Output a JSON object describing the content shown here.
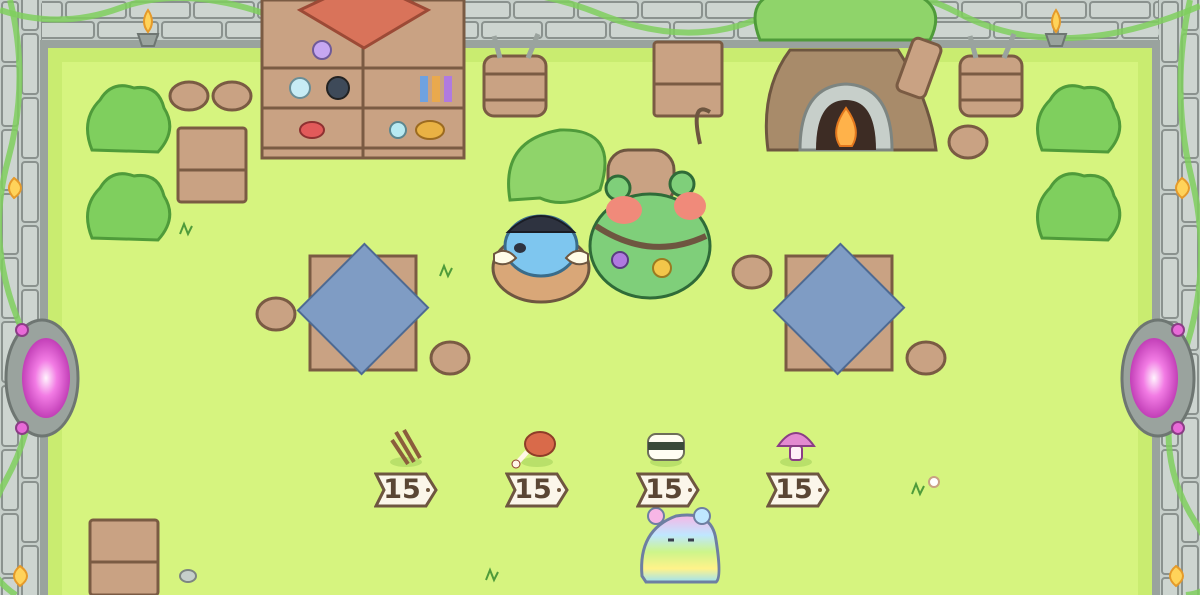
{
  "shop": {
    "items": [
      {
        "name": "wooden-sticks",
        "icon": "sticks-icon",
        "price": "15"
      },
      {
        "name": "meat-drumstick",
        "icon": "meat-icon",
        "price": "15"
      },
      {
        "name": "sushi-roll",
        "icon": "sushi-icon",
        "price": "15"
      },
      {
        "name": "pink-mushroom",
        "icon": "mushroom-icon",
        "price": "15"
      }
    ]
  },
  "colors": {
    "grass": "#d6f47f",
    "grass_edge": "#b9e06a",
    "stone": "#c2cbc6",
    "stone_outline": "#7d8581",
    "wood": "#b89272",
    "wood_dark": "#7a5b43",
    "table_cloth": "#7f9cc4",
    "bush": "#7fcf5e",
    "tag_fill": "#fbf6ea",
    "tag_text": "#5a4634",
    "portal": "#e86ad8"
  }
}
